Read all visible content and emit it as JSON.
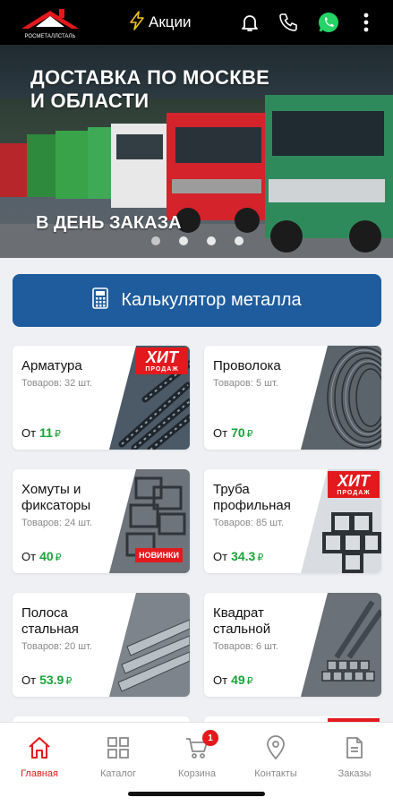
{
  "topbar": {
    "logo_text": "РОСМЕТАЛЛСТАЛЬ",
    "promo_label": "Акции",
    "icons": [
      "bolt-icon",
      "bell-icon",
      "phone-icon",
      "whatsapp-icon",
      "more-vertical-icon"
    ]
  },
  "hero": {
    "title": "ДОСТАВКА ПО МОСКВЕ И ОБЛАСТИ",
    "subtitle": "В ДЕНЬ ЗАКАЗА",
    "slides": 4,
    "active_slide": 1
  },
  "calculator": {
    "label": "Калькулятор металла",
    "icon": "calculator-icon"
  },
  "products": [
    {
      "name": "Арматура",
      "count": "Товаров: 32 шт.",
      "price_prefix": "От",
      "price": "11",
      "currency": "₽",
      "badge": "ХИТ",
      "badge_sub": "ПРОДАЖ"
    },
    {
      "name": "Проволока",
      "count": "Товаров: 5 шт.",
      "price_prefix": "От",
      "price": "70",
      "currency": "₽"
    },
    {
      "name": "Хомуты и фиксаторы",
      "count": "Товаров: 24 шт.",
      "price_prefix": "От",
      "price": "40",
      "currency": "₽",
      "badge_new": "НОВИНКИ"
    },
    {
      "name": "Труба профильная",
      "count": "Товаров: 85 шт.",
      "price_prefix": "От",
      "price": "34.3",
      "currency": "₽",
      "badge": "ХИТ",
      "badge_sub": "ПРОДАЖ"
    },
    {
      "name": "Полоса стальная",
      "count": "Товаров: 20 шт.",
      "price_prefix": "От",
      "price": "53.9",
      "currency": "₽"
    },
    {
      "name": "Квадрат стальной",
      "count": "Товаров: 6 шт.",
      "price_prefix": "От",
      "price": "49",
      "currency": "₽"
    }
  ],
  "bottom_nav": {
    "items": [
      {
        "label": "Главная",
        "icon": "home-icon",
        "active": true
      },
      {
        "label": "Каталог",
        "icon": "grid-icon"
      },
      {
        "label": "Корзина",
        "icon": "cart-icon",
        "badge": "1"
      },
      {
        "label": "Контакты",
        "icon": "location-pin-icon"
      },
      {
        "label": "Заказы",
        "icon": "document-icon"
      }
    ]
  },
  "colors": {
    "accent_red": "#e3191d",
    "calc_blue": "#1e5c9e",
    "price_green": "#1aa338"
  }
}
